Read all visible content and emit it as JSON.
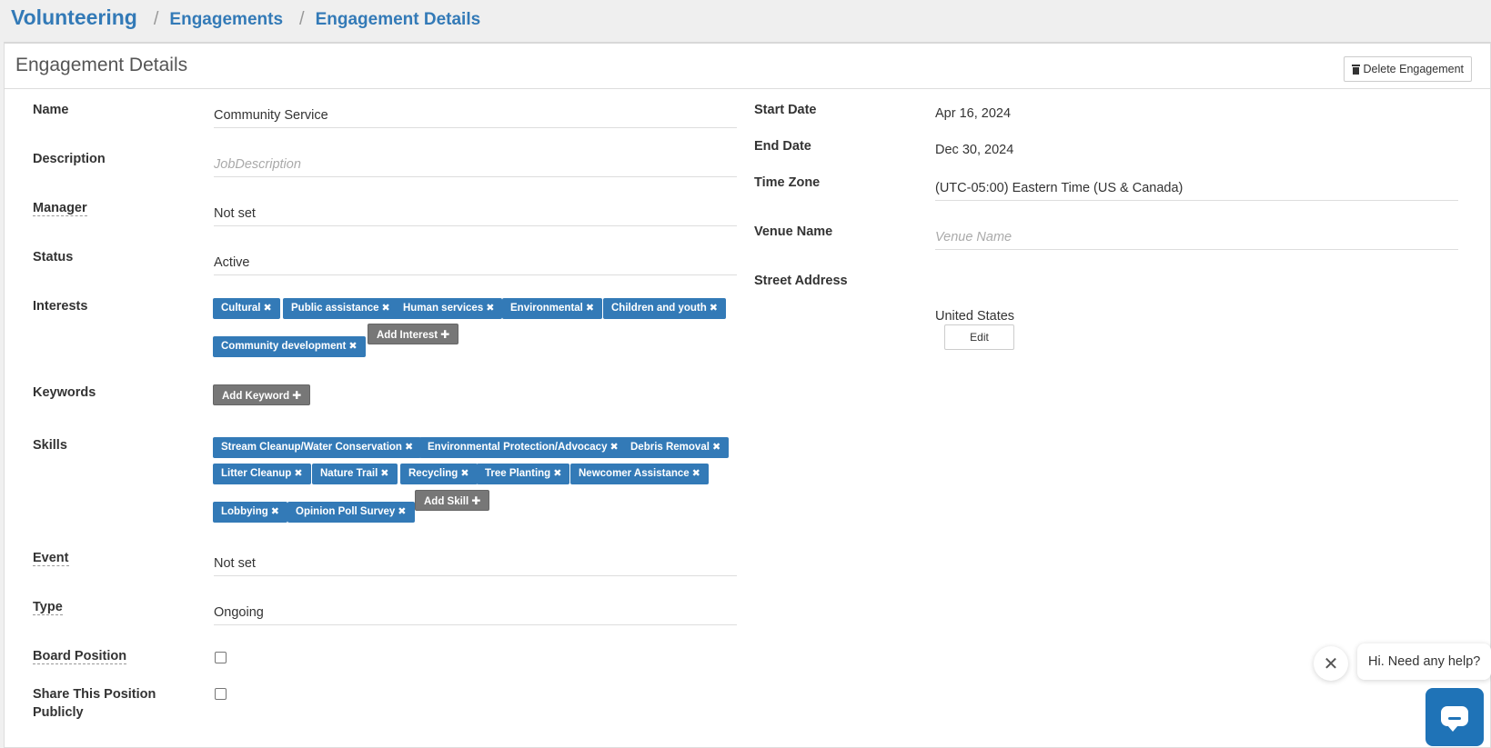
{
  "breadcrumb": {
    "root": "Volunteering",
    "items": [
      "Engagements",
      "Engagement Details"
    ]
  },
  "panel": {
    "title": "Engagement Details",
    "delete_label": "Delete Engagement"
  },
  "left": {
    "name_label": "Name",
    "name_value": "Community Service",
    "description_label": "Description",
    "description_placeholder": "JobDescription",
    "manager_label": "Manager",
    "manager_value": "Not set",
    "status_label": "Status",
    "status_value": "Active",
    "interests_label": "Interests",
    "interests": [
      "Cultural",
      "Public assistance",
      "Human services",
      "Environmental",
      "Children and youth",
      "Community development"
    ],
    "add_interest_label": "Add Interest",
    "keywords_label": "Keywords",
    "add_keyword_label": "Add Keyword",
    "skills_label": "Skills",
    "skills": [
      "Stream Cleanup/Water Conservation",
      "Environmental Protection/Advocacy",
      "Debris Removal",
      "Litter Cleanup",
      "Nature Trail",
      "Recycling",
      "Tree Planting",
      "Newcomer Assistance",
      "Lobbying",
      "Opinion Poll Survey"
    ],
    "add_skill_label": "Add Skill",
    "event_label": "Event",
    "event_value": "Not set",
    "type_label": "Type",
    "type_value": "Ongoing",
    "board_position_label": "Board Position",
    "share_label_line1": "Share This Position",
    "share_label_line2": "Publicly"
  },
  "right": {
    "start_date_label": "Start Date",
    "start_date_value": "Apr 16, 2024",
    "end_date_label": "End Date",
    "end_date_value": "Dec 30, 2024",
    "time_zone_label": "Time Zone",
    "time_zone_value": "(UTC-05:00) Eastern Time (US & Canada)",
    "venue_name_label": "Venue Name",
    "venue_name_placeholder": "Venue Name",
    "street_address_label": "Street Address",
    "country_value": "United States",
    "edit_label": "Edit"
  },
  "chat": {
    "greeting": "Hi. Need any help?"
  }
}
